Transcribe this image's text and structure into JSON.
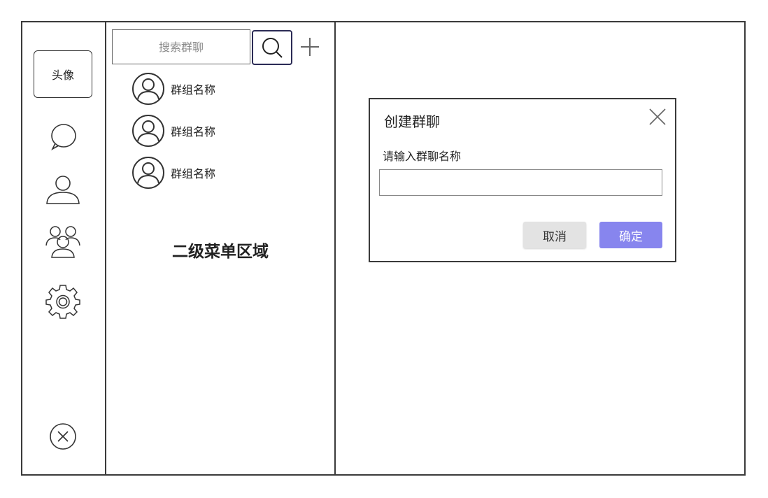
{
  "rail": {
    "avatar_label": "头像",
    "icons": [
      "chat-bubble-icon",
      "user-icon",
      "group-icon",
      "settings-gear-icon",
      "close-circle-icon"
    ]
  },
  "secondary": {
    "search_placeholder": "搜索群聊",
    "search_value": "",
    "area_label": "二级菜单区域",
    "groups": [
      {
        "name": "群组名称",
        "icon": "user-avatar-icon"
      },
      {
        "name": "群组名称",
        "icon": "user-avatar-icon"
      },
      {
        "name": "群组名称",
        "icon": "user-avatar-icon"
      }
    ]
  },
  "dialog": {
    "title": "创建群聊",
    "label": "请输入群聊名称",
    "input_value": "",
    "cancel_label": "取消",
    "confirm_label": "确定"
  },
  "colors": {
    "primary_button": "#8785ee",
    "secondary_button": "#e3e3e3",
    "search_button_border": "#2b2b55",
    "border": "#3a3a3a"
  }
}
